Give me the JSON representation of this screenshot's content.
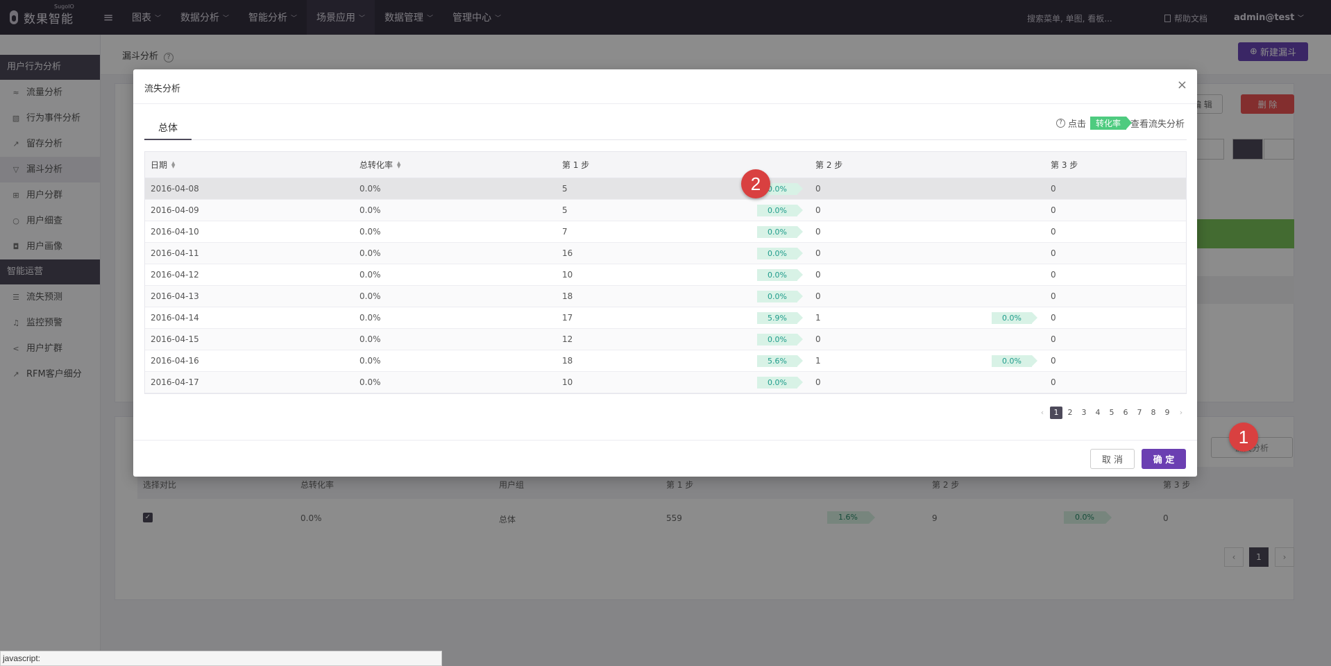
{
  "topnav": {
    "logo_text": "数果智能",
    "logo_sup": "SugoIO",
    "menus": [
      {
        "label": "图表"
      },
      {
        "label": "数据分析"
      },
      {
        "label": "智能分析"
      },
      {
        "label": "场景应用"
      },
      {
        "label": "数据管理"
      },
      {
        "label": "管理中心"
      }
    ],
    "search_placeholder": "搜索菜单, 单图, 看板...",
    "help_label": "帮助文档",
    "user_label": "admin@test"
  },
  "sidebar": {
    "group1": "用户行为分析",
    "items1": [
      {
        "label": "流量分析",
        "icon": "traffic-icon"
      },
      {
        "label": "行为事件分析",
        "icon": "event-icon"
      },
      {
        "label": "留存分析",
        "icon": "retention-icon"
      },
      {
        "label": "漏斗分析",
        "icon": "funnel-icon"
      },
      {
        "label": "用户分群",
        "icon": "group-icon"
      },
      {
        "label": "用户细查",
        "icon": "search-icon"
      },
      {
        "label": "用户画像",
        "icon": "portrait-icon"
      }
    ],
    "group2": "智能运营",
    "items2": [
      {
        "label": "流失预测",
        "icon": "list-icon"
      },
      {
        "label": "监控预警",
        "icon": "bell-icon"
      },
      {
        "label": "用户扩群",
        "icon": "share-icon"
      },
      {
        "label": "RFM客户细分",
        "icon": "chart-icon"
      }
    ]
  },
  "page": {
    "title": "漏斗分析",
    "new_button": "新建漏斗",
    "edit_button": "编 辑",
    "delete_button": "删 除",
    "lost_button": "流失分析",
    "bg_headers": [
      "选择对比",
      "总转化率",
      "用户组",
      "第 1 步",
      "第 2 步",
      "第 3 步"
    ],
    "bg_row": {
      "rate": "0.0%",
      "group": "总体",
      "step1": "559",
      "r1": "1.6%",
      "step2": "9",
      "r2": "0.0%",
      "step3": "0"
    },
    "bg_page": "1"
  },
  "modal": {
    "title": "流失分析",
    "tab": "总体",
    "hint_prefix": "点击",
    "hint_tag": "转化率",
    "hint_suffix": "查看流失分析",
    "headers": [
      "日期",
      "总转化率",
      "第 1 步",
      "第 2 步",
      "第 3 步"
    ],
    "rows": [
      {
        "date": "2016-04-08",
        "total": "0.0%",
        "s1": "5",
        "r1": "0.0%",
        "s2": "0",
        "r2": "",
        "s3": "0"
      },
      {
        "date": "2016-04-09",
        "total": "0.0%",
        "s1": "5",
        "r1": "0.0%",
        "s2": "0",
        "r2": "",
        "s3": "0"
      },
      {
        "date": "2016-04-10",
        "total": "0.0%",
        "s1": "7",
        "r1": "0.0%",
        "s2": "0",
        "r2": "",
        "s3": "0"
      },
      {
        "date": "2016-04-11",
        "total": "0.0%",
        "s1": "16",
        "r1": "0.0%",
        "s2": "0",
        "r2": "",
        "s3": "0"
      },
      {
        "date": "2016-04-12",
        "total": "0.0%",
        "s1": "10",
        "r1": "0.0%",
        "s2": "0",
        "r2": "",
        "s3": "0"
      },
      {
        "date": "2016-04-13",
        "total": "0.0%",
        "s1": "18",
        "r1": "0.0%",
        "s2": "0",
        "r2": "",
        "s3": "0"
      },
      {
        "date": "2016-04-14",
        "total": "0.0%",
        "s1": "17",
        "r1": "5.9%",
        "s2": "1",
        "r2": "0.0%",
        "s3": "0"
      },
      {
        "date": "2016-04-15",
        "total": "0.0%",
        "s1": "12",
        "r1": "0.0%",
        "s2": "0",
        "r2": "",
        "s3": "0"
      },
      {
        "date": "2016-04-16",
        "total": "0.0%",
        "s1": "18",
        "r1": "5.6%",
        "s2": "1",
        "r2": "0.0%",
        "s3": "0"
      },
      {
        "date": "2016-04-17",
        "total": "0.0%",
        "s1": "10",
        "r1": "0.0%",
        "s2": "0",
        "r2": "",
        "s3": "0"
      }
    ],
    "pages": [
      "1",
      "2",
      "3",
      "4",
      "5",
      "6",
      "7",
      "8",
      "9"
    ],
    "current_page": "1",
    "cancel_button": "取 消",
    "ok_button": "确 定"
  },
  "markers": [
    "1",
    "2"
  ],
  "statusbar": "javascript:"
}
